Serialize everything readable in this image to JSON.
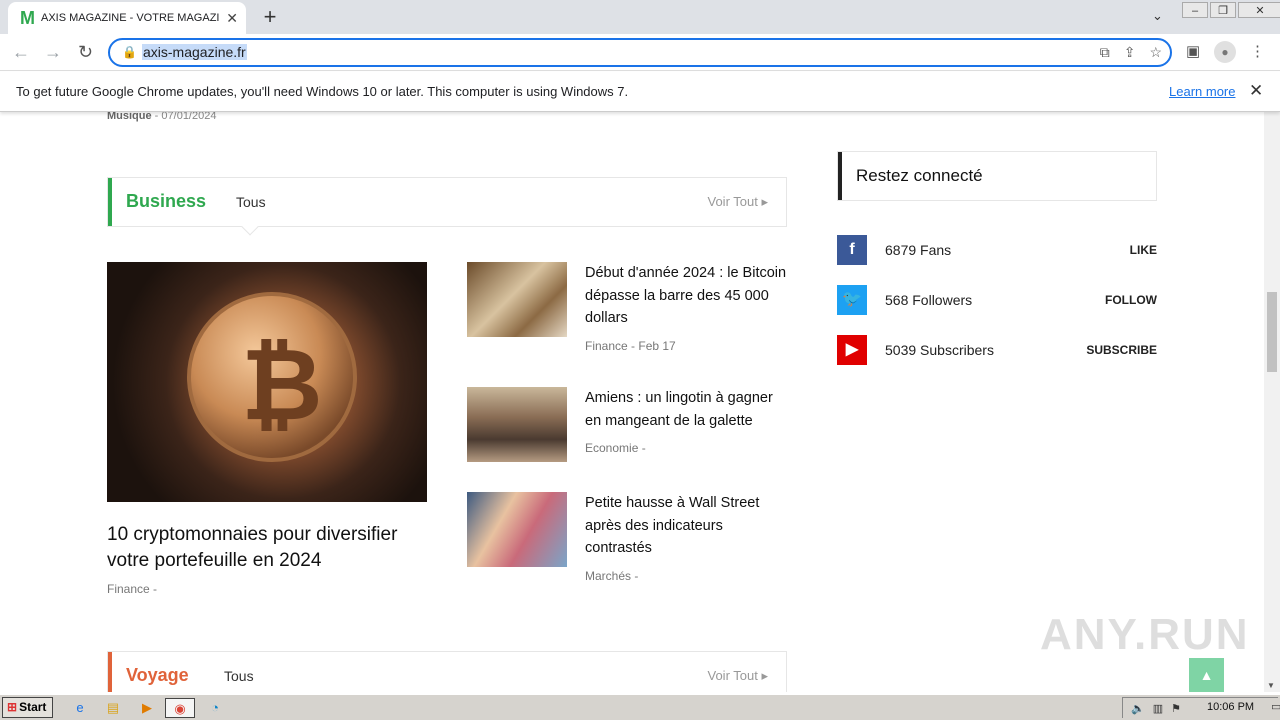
{
  "browser": {
    "tab_title": "AXIS MAGAZINE - VOTRE MAGAZINE",
    "favicon_letter": "M",
    "new_tab": "+",
    "url": "axis-magazine.fr"
  },
  "infobar": {
    "message": "To get future Google Chrome updates, you'll need Windows 10 or later. This computer is using Windows 7.",
    "learn_more": "Learn more"
  },
  "prev": {
    "category": "Musique",
    "date": "07/01/2024"
  },
  "business": {
    "name": "Business",
    "tab": "Tous",
    "voir": "Voir Tout",
    "accent": "#2fa84f",
    "main": {
      "title": "10 cryptomonnaies pour diversifier votre portefeuille en 2024",
      "category": "Finance"
    },
    "items": [
      {
        "title": "Début d'année 2024 : le Bitcoin dépasse la barre des 45 000 dollars",
        "category": "Finance",
        "date": "Feb 17"
      },
      {
        "title": "Amiens : un lingotin à gagner en mangeant de la galette",
        "category": "Economie",
        "date": ""
      },
      {
        "title": "Petite hausse à Wall Street après des indicateurs contrastés",
        "category": "Marchés",
        "date": ""
      }
    ]
  },
  "voyage": {
    "name": "Voyage",
    "tab": "Tous",
    "voir": "Voir Tout",
    "accent": "#e0633a"
  },
  "sidebar": {
    "title": "Restez connecté",
    "social": [
      {
        "icon": "facebook-icon",
        "count": "6879 Fans",
        "action": "LIKE",
        "color": "#3b5998"
      },
      {
        "icon": "twitter-icon",
        "count": "568 Followers",
        "action": "FOLLOW",
        "color": "#1da1f2"
      },
      {
        "icon": "youtube-icon",
        "count": "5039 Subscribers",
        "action": "SUBSCRIBE",
        "color": "#e00000"
      }
    ]
  },
  "watermark": "ANY.RUN",
  "taskbar": {
    "start": "Start",
    "clock": "10:06 PM"
  }
}
